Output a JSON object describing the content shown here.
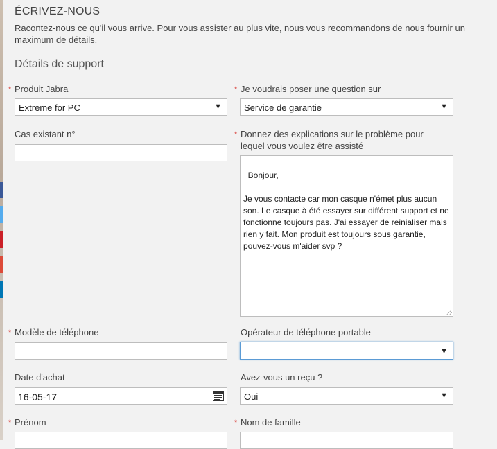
{
  "header": {
    "title": "ÉCRIVEZ-NOUS",
    "intro": "Racontez-nous ce qu'il vous arrive. Pour vous assister au plus vite, nous vous recommandons de nous fournir un maximum de détails.",
    "section_title": "Détails de support"
  },
  "form": {
    "required_mark": "*",
    "product": {
      "label": "Produit Jabra",
      "value": "Extreme for PC"
    },
    "question": {
      "label": "Je voudrais poser une question sur",
      "value": "Service de garantie"
    },
    "case": {
      "label": "Cas existant n°",
      "value": ""
    },
    "explain": {
      "label": "Donnez des explications sur le problème pour lequel vous voulez être assisté",
      "value": "Bonjour,\n\nJe vous contacte car mon casque n'émet plus aucun son. Le casque à été essayer sur différent support et ne fonctionne toujours pas. J'ai essayer de reinialiser mais rien y fait. Mon produit est toujours sous garantie, pouvez-vous m'aider svp ?"
    },
    "phone_model": {
      "label": "Modèle de téléphone",
      "value": ""
    },
    "operator": {
      "label": "Opérateur de téléphone portable",
      "value": ""
    },
    "purchase_date": {
      "label": "Date d'achat",
      "value": "16-05-17"
    },
    "receipt": {
      "label": "Avez-vous un reçu ?",
      "value": "Oui"
    },
    "first_name": {
      "label": "Prénom",
      "value": ""
    },
    "last_name": {
      "label": "Nom de famille",
      "value": ""
    }
  },
  "icons": {
    "dropdown": "chevron-down-icon",
    "calendar": "calendar-icon"
  },
  "colors": {
    "required": "#d9403a",
    "focus": "#5b9bd5",
    "background": "#f2f2f2"
  }
}
